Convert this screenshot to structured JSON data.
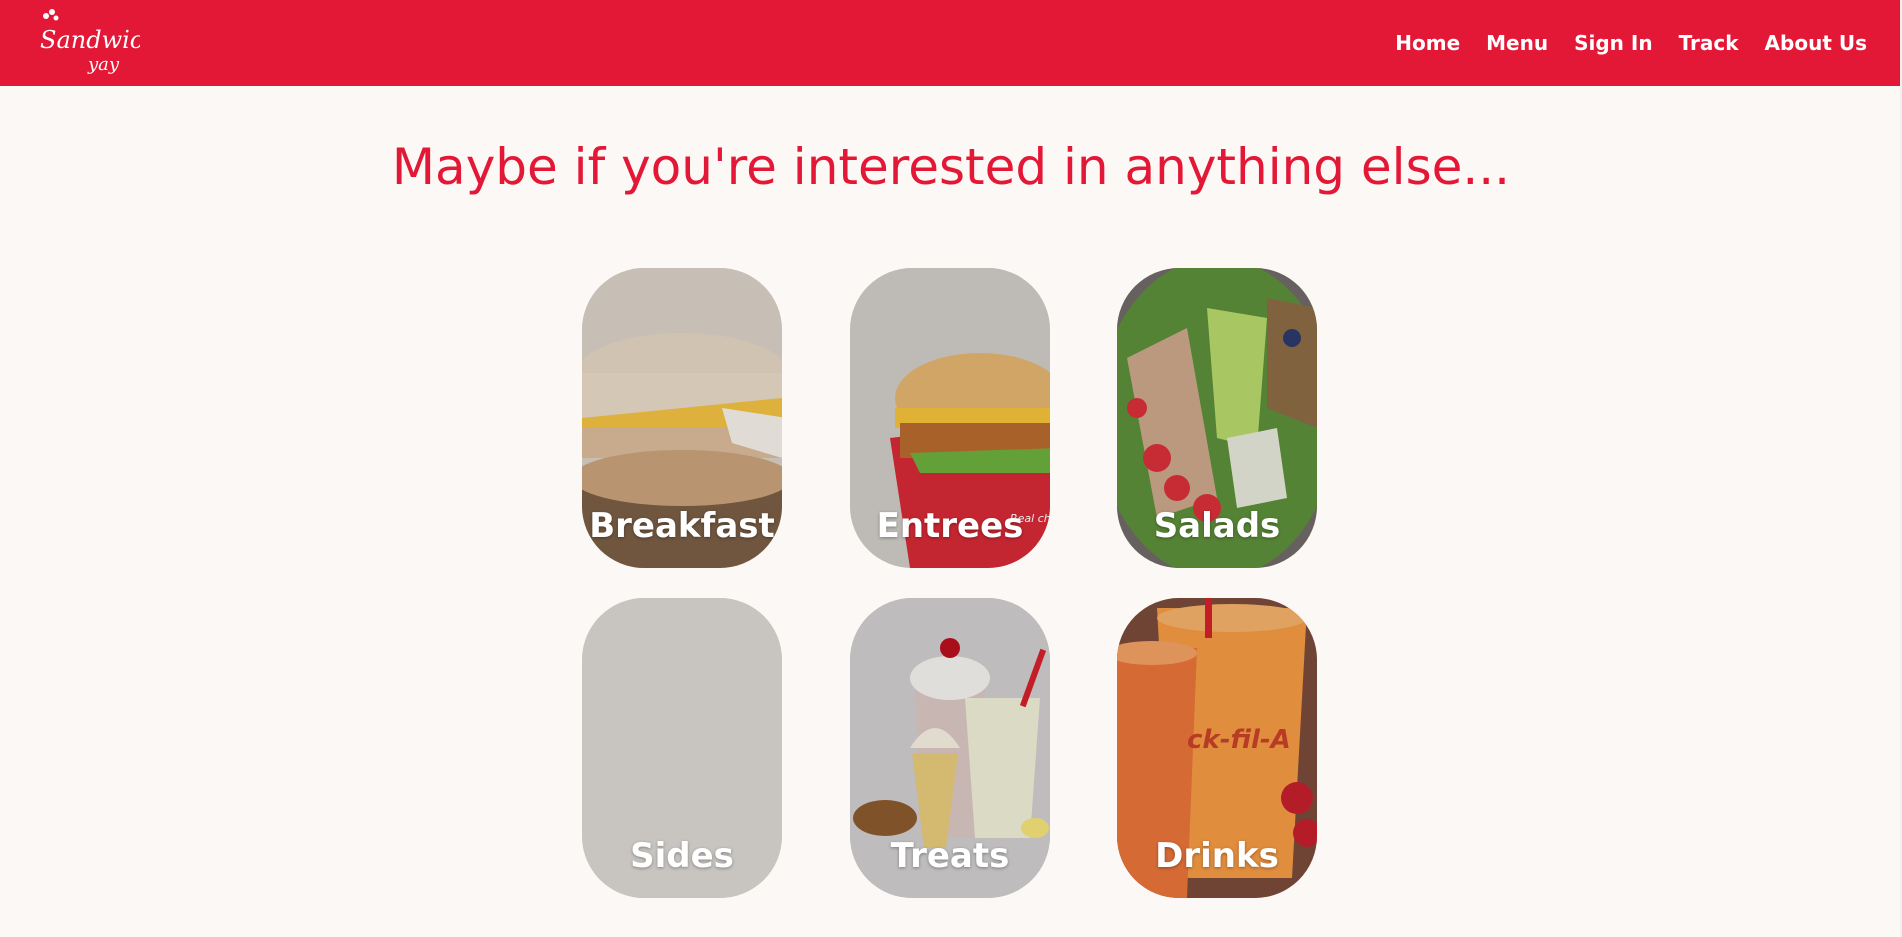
{
  "brand": {
    "logo_line1": "Sandwich",
    "logo_line2": "yay",
    "primary_color": "#e31837",
    "background_color": "#fcf8f5"
  },
  "nav": {
    "items": [
      {
        "label": "Home"
      },
      {
        "label": "Menu"
      },
      {
        "label": "Sign In"
      },
      {
        "label": "Track"
      },
      {
        "label": "About Us"
      }
    ]
  },
  "main": {
    "headline": "Maybe if you're interested in anything else..."
  },
  "categories": [
    {
      "label": "Breakfast",
      "image": "breakfast-sandwich"
    },
    {
      "label": "Entrees",
      "image": "chicken-sandwich"
    },
    {
      "label": "Salads",
      "image": "cobb-salad"
    },
    {
      "label": "Sides",
      "image": "sides-placeholder"
    },
    {
      "label": "Treats",
      "image": "milkshakes-icecream"
    },
    {
      "label": "Drinks",
      "image": "iced-tea-lemonade"
    }
  ]
}
